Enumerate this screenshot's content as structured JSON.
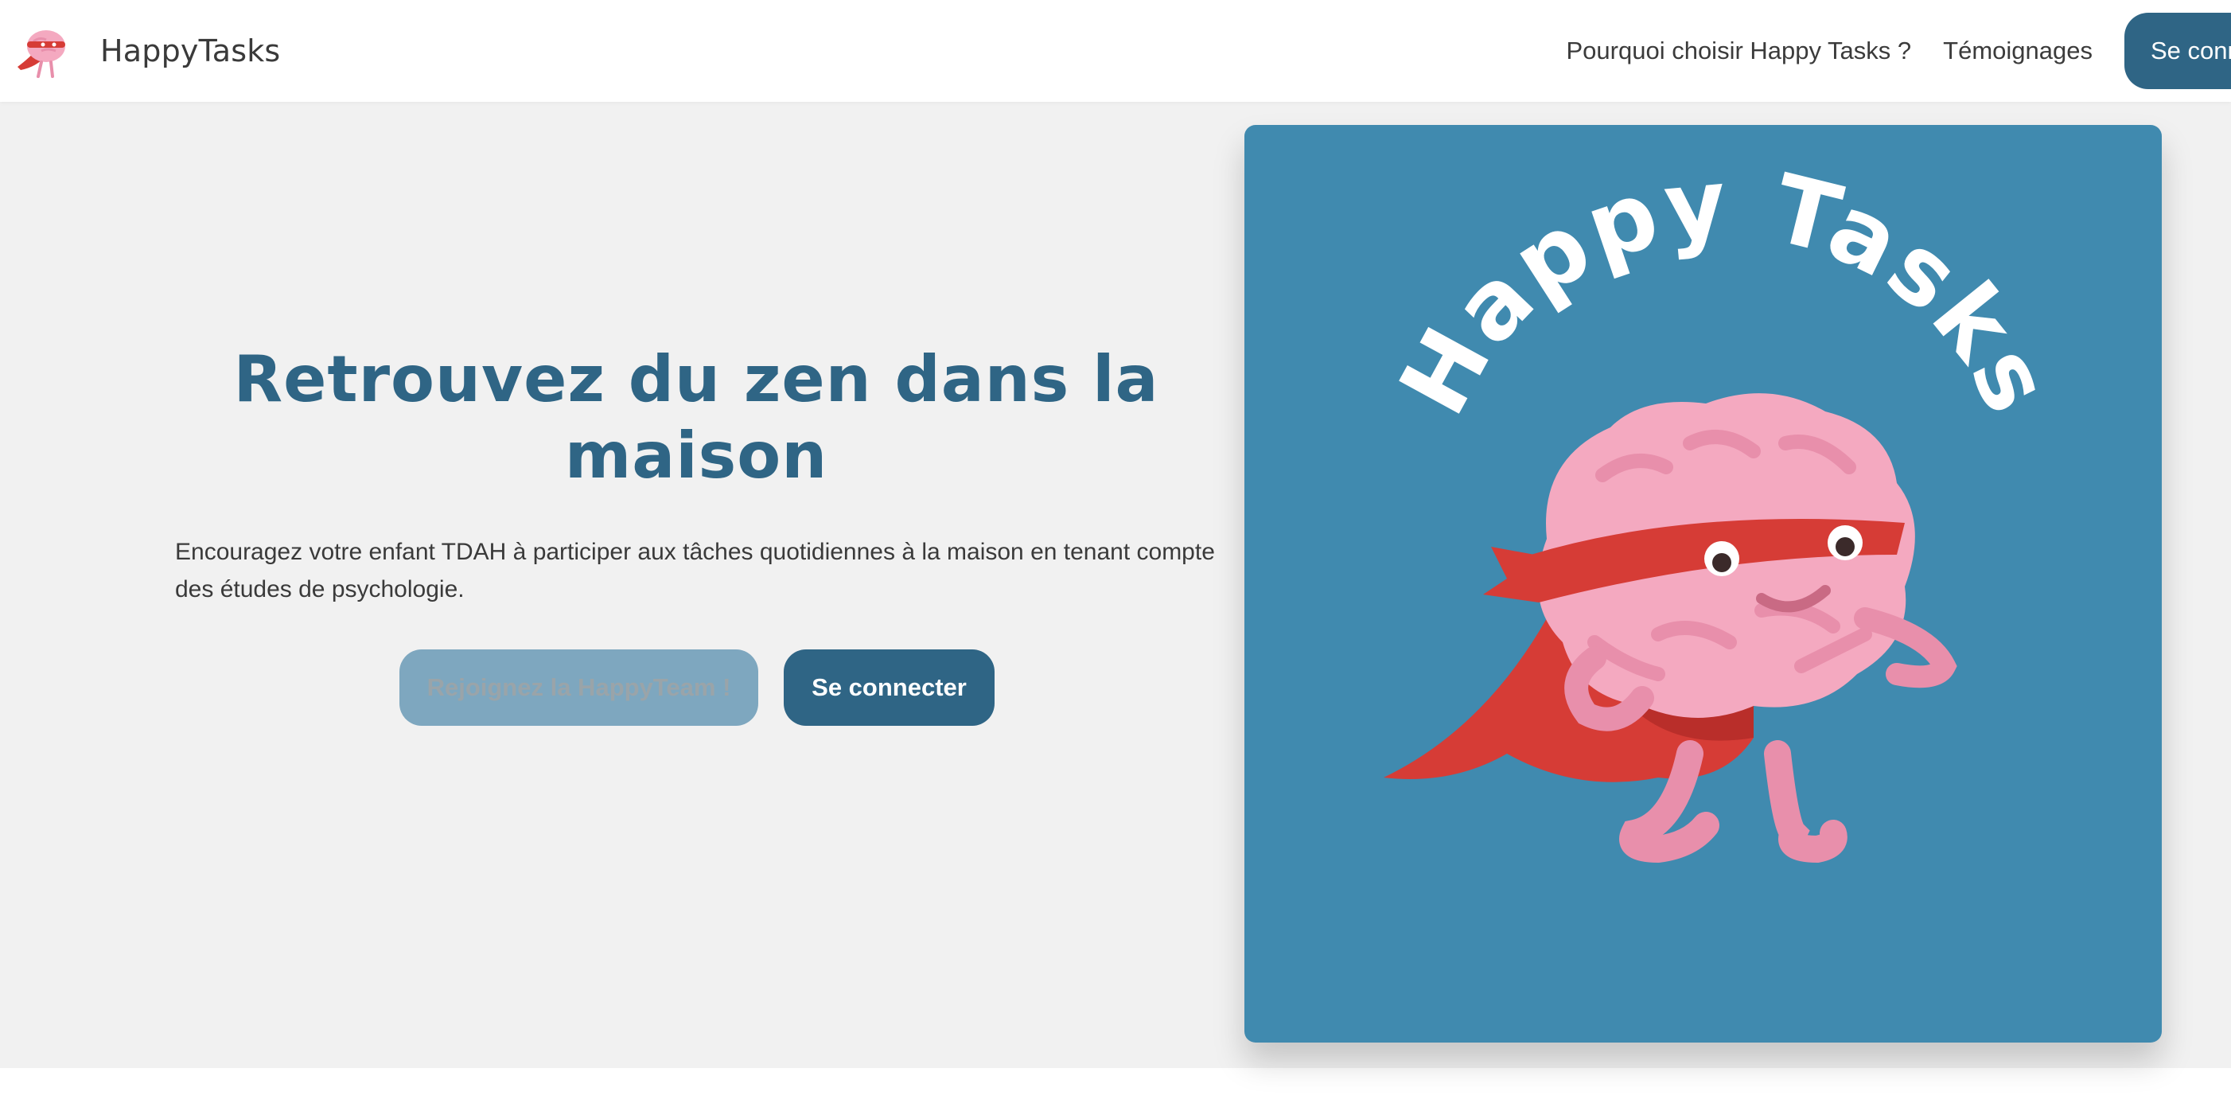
{
  "navbar": {
    "brand_name": "HappyTasks",
    "links": [
      {
        "label": "Pourquoi choisir Happy Tasks ?"
      },
      {
        "label": "Témoignages"
      }
    ],
    "login_label": "Se conn"
  },
  "hero": {
    "title": "Retrouvez du zen dans la maison",
    "text": "Encouragez votre enfant TDAH à participer aux tâches quotidiennes à la maison en tenant compte des études de psychologie.",
    "join_button": "Rejoignez la HappyTeam !",
    "login_button": "Se connecter",
    "illustration_text": "Happy Tasks"
  },
  "colors": {
    "primary": "#2f6585",
    "hero_background": "#f1f1f1",
    "card_background": "#408aaf",
    "join_button": "#7ea7bf",
    "brain_pink": "#f4a9c0",
    "mask_red": "#d63c36"
  },
  "icons": {
    "brand_logo": "superhero-brain-icon",
    "illustration": "superhero-brain-illustration"
  }
}
